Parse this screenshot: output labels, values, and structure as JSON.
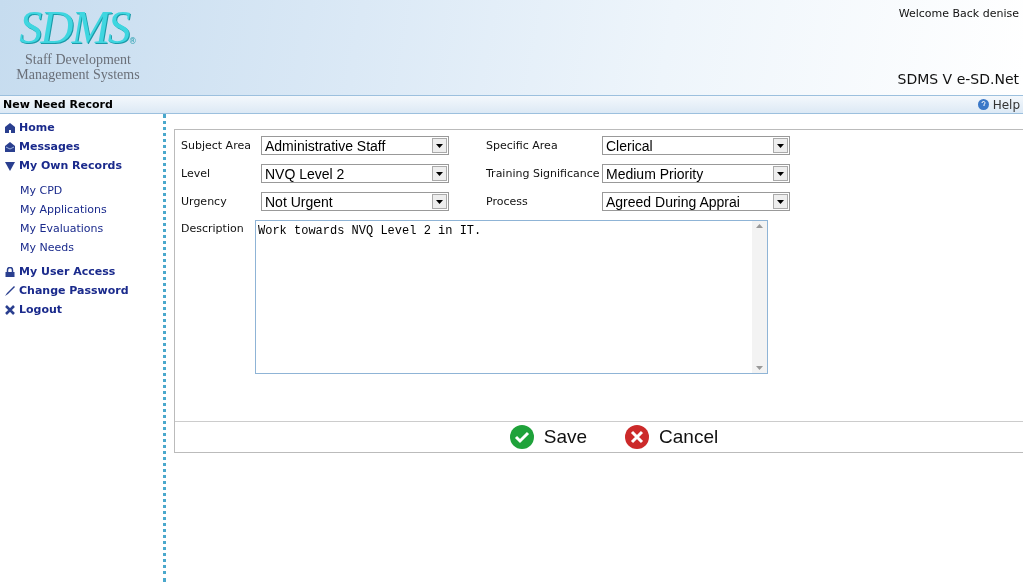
{
  "header": {
    "logo": "SDMS",
    "logo_mark": "®",
    "tagline_1": "Staff Development",
    "tagline_2": "Management Systems",
    "welcome": "Welcome Back denise",
    "product": "SDMS V e-SD.Net"
  },
  "title_bar": {
    "title": "New Need Record",
    "help": "Help"
  },
  "sidebar": {
    "items": [
      {
        "label": "Home"
      },
      {
        "label": "Messages"
      },
      {
        "label": "My Own Records",
        "expanded": true,
        "children": [
          {
            "label": "My CPD"
          },
          {
            "label": "My Applications"
          },
          {
            "label": "My Evaluations"
          },
          {
            "label": "My Needs"
          }
        ]
      },
      {
        "label": "My User Access"
      },
      {
        "label": "Change Password"
      },
      {
        "label": "Logout"
      }
    ]
  },
  "form": {
    "fields": [
      {
        "label": "Subject Area",
        "value": "Administrative Staff"
      },
      {
        "label": "Specific Area",
        "value": "Clerical"
      },
      {
        "label": "Level",
        "value": "NVQ Level 2"
      },
      {
        "label": "Training Significance",
        "value": "Medium Priority"
      },
      {
        "label": "Urgency",
        "value": "Not Urgent"
      },
      {
        "label": "Process",
        "value": "Agreed During Apprai"
      }
    ],
    "description": {
      "label": "Description",
      "value": "Work towards NVQ Level 2 in IT."
    },
    "buttons": [
      {
        "kind": "save",
        "label": "Save"
      },
      {
        "kind": "cancel",
        "label": "Cancel"
      }
    ]
  }
}
